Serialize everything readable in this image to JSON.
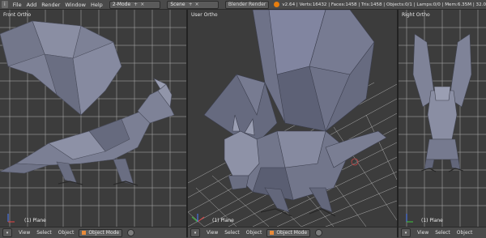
{
  "topbar": {
    "menus": [
      "File",
      "Add",
      "Render",
      "Window",
      "Help"
    ],
    "screen_layout": "2-Mode",
    "scene": "Scene",
    "renderer": "Blender Render",
    "stats": "v2.64 | Verts:16432 | Faces:1458 | Tris:1458 | Objects:0/1 | Lamps:0/0 | Mem:6.35M | 32.0"
  },
  "viewports": {
    "left": {
      "label": "Front Ortho",
      "object": "(1) Plane"
    },
    "center": {
      "label": "User Ortho",
      "object": "(1) Plane"
    },
    "right": {
      "label": "Right Ortho",
      "object": "(1) Plane"
    }
  },
  "header": {
    "menus": [
      "View",
      "Select",
      "Object"
    ],
    "mode": "Object Mode"
  },
  "colors": {
    "mesh": "#7b7f94",
    "mesh_dark": "#5b5f72",
    "grid": "#dcdcdc",
    "background": "#3c3c3c"
  }
}
